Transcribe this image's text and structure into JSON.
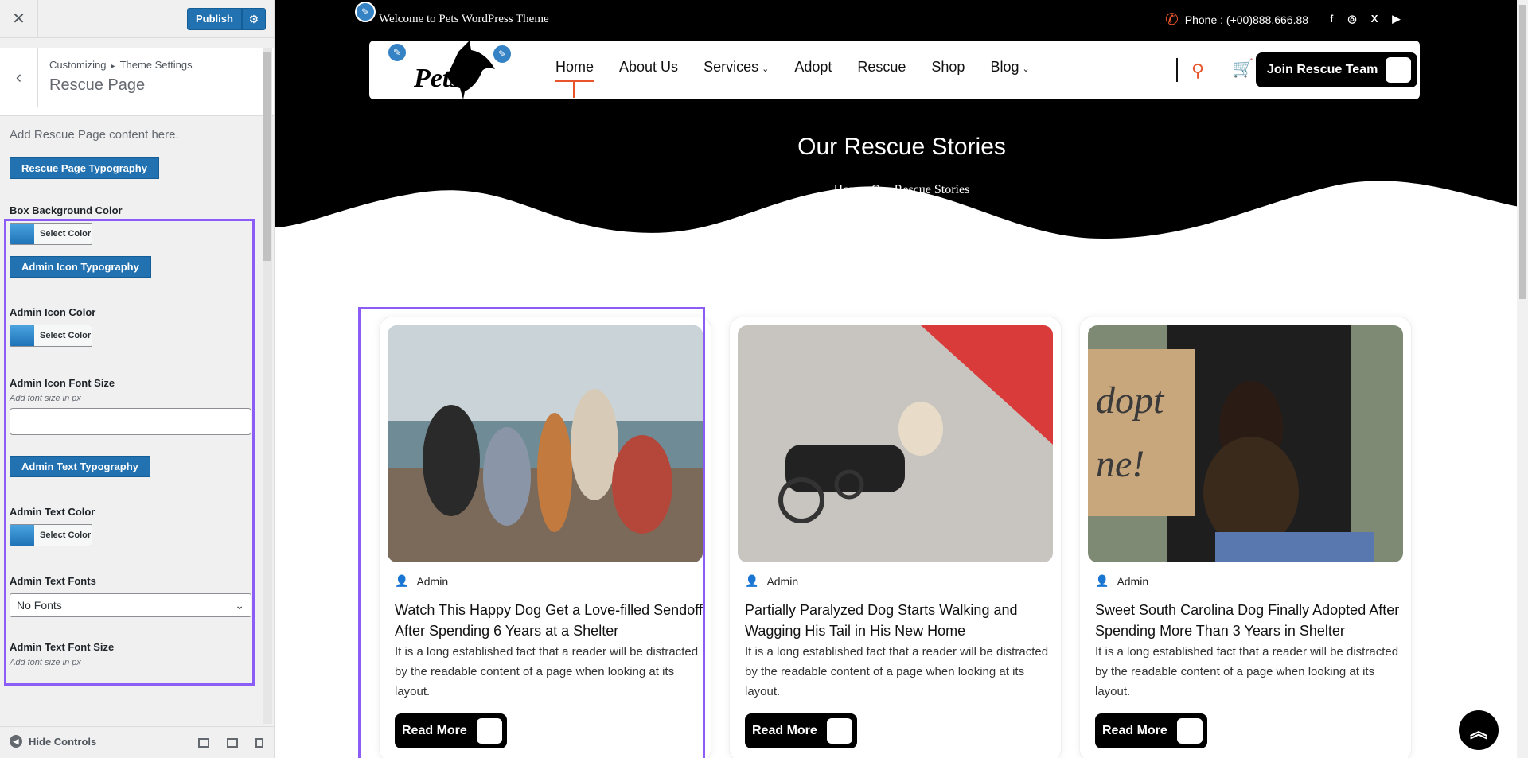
{
  "customizer": {
    "close_icon": "close-icon",
    "publish_label": "Publish",
    "breadcrumb_root": "Customizing",
    "breadcrumb_parent": "Theme Settings",
    "section_title": "Rescue Page",
    "description": "Add Rescue Page content here.",
    "typography_button": "Rescue Page Typography",
    "controls": {
      "box_bg_label": "Box Background Color",
      "select_color": "Select Color",
      "admin_icon_typography": "Admin Icon Typography",
      "admin_icon_color_label": "Admin Icon Color",
      "admin_icon_font_size_label": "Admin Icon Font Size",
      "font_size_hint": "Add font size in px",
      "admin_text_typography": "Admin Text Typography",
      "admin_text_color_label": "Admin Text Color",
      "admin_text_fonts_label": "Admin Text Fonts",
      "admin_text_fonts_value": "No Fonts",
      "admin_text_font_size_label": "Admin Text Font Size",
      "font_size_hint_2": "Add font size in px"
    },
    "hide_controls": "Hide Controls"
  },
  "site": {
    "welcome": "Welcome to Pets WordPress Theme",
    "phone": "Phone : (+00)888.666.88",
    "socials": [
      "f",
      "◎",
      "X",
      "▶"
    ],
    "logo_text": "Pets",
    "menu": [
      {
        "label": "Home",
        "active": true,
        "dropdown": false
      },
      {
        "label": "About Us",
        "active": false,
        "dropdown": false
      },
      {
        "label": "Services",
        "active": false,
        "dropdown": true
      },
      {
        "label": "Adopt",
        "active": false,
        "dropdown": false
      },
      {
        "label": "Rescue",
        "active": false,
        "dropdown": false
      },
      {
        "label": "Shop",
        "active": false,
        "dropdown": false
      },
      {
        "label": "Blog",
        "active": false,
        "dropdown": true
      }
    ],
    "join_button": "Join Rescue Team",
    "hero_title": "Our Rescue Stories",
    "breadcrumb_home": "Home",
    "breadcrumb_current": "Our Rescue Stories",
    "accent": "#e8542b"
  },
  "posts": [
    {
      "author": "Admin",
      "title": "Watch This Happy Dog Get a Love-filled Sendoff After Spending 6 Years at a Shelter",
      "excerpt": "It is a long established fact that a reader will be distracted by the readable content of a page when looking at its layout.",
      "button": "Read More"
    },
    {
      "author": "Admin",
      "title": "Partially Paralyzed Dog Starts Walking and Wagging His Tail in His New Home",
      "excerpt": "It is a long established fact that a reader will be distracted by the readable content of a page when looking at its layout.",
      "button": "Read More"
    },
    {
      "author": "Admin",
      "title": "Sweet South Carolina Dog Finally Adopted After Spending More Than 3 Years in Shelter",
      "excerpt": "It is a long established fact that a reader will be distracted by the readable content of a page when looking at its layout.",
      "button": "Read More"
    }
  ]
}
